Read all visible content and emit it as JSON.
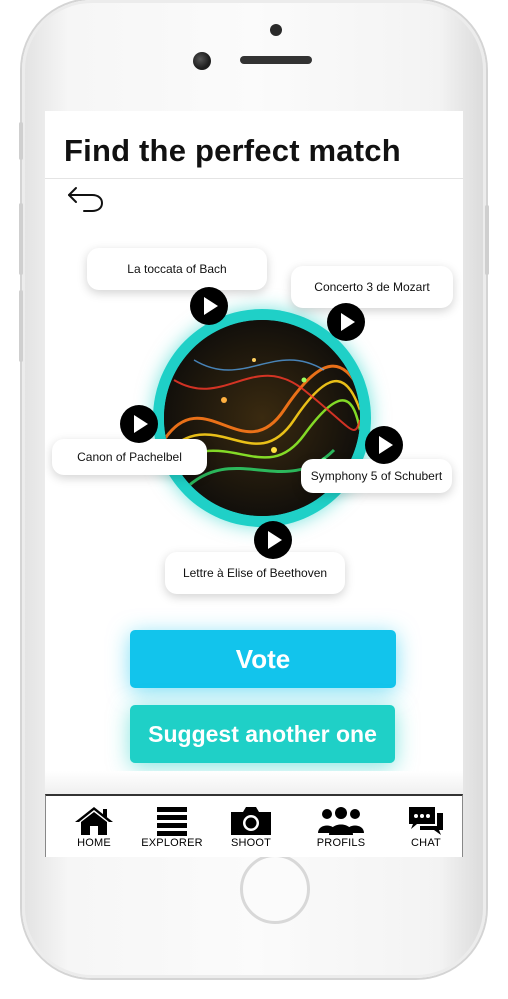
{
  "header": {
    "title": "Find the perfect match"
  },
  "songs": [
    {
      "title": "La toccata of Bach"
    },
    {
      "title": "Concerto 3 de Mozart"
    },
    {
      "title": "Canon of Pachelbel"
    },
    {
      "title": "Symphony 5 of Schubert"
    },
    {
      "title": "Lettre à Elise of Beethoven"
    }
  ],
  "actions": {
    "vote_label": "Vote",
    "suggest_label": "Suggest another one"
  },
  "colors": {
    "vote": "#12c4ec",
    "suggest": "#1fd0c7",
    "ring": "#1fd0c7"
  },
  "tabbar": {
    "items": [
      {
        "label": "HOME",
        "icon": "home-icon"
      },
      {
        "label": "EXPLORER",
        "icon": "list-icon"
      },
      {
        "label": "SHOOT",
        "icon": "camera-icon"
      },
      {
        "label": "PROFILS",
        "icon": "users-icon"
      },
      {
        "label": "CHAT",
        "icon": "chat-icon"
      }
    ]
  }
}
